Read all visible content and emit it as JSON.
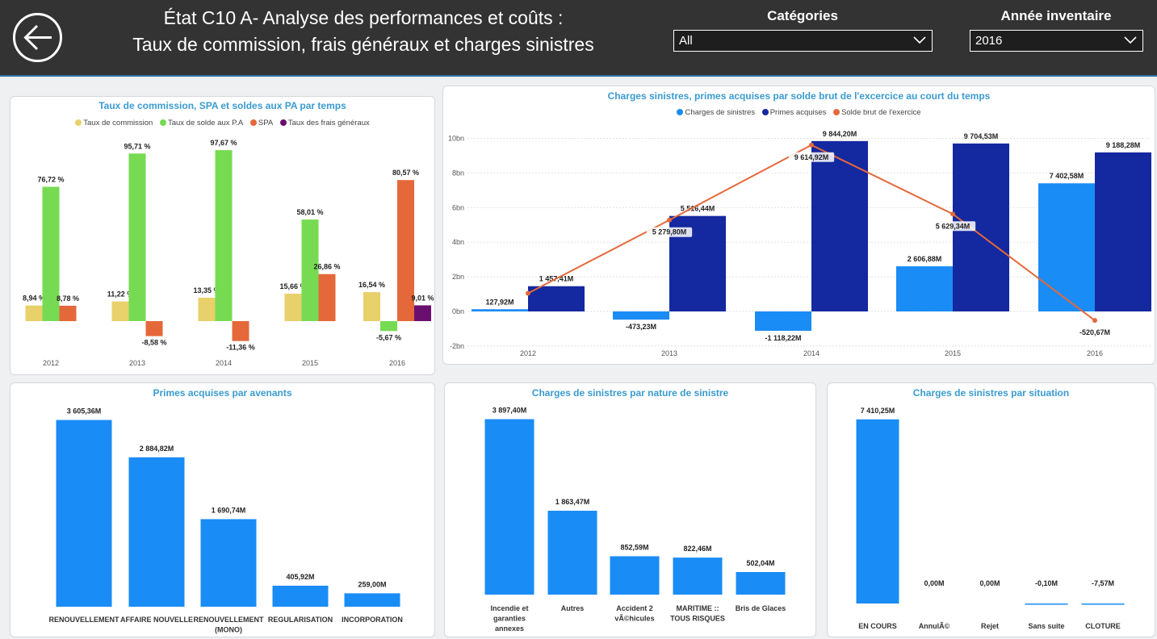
{
  "header": {
    "title_line1": "État C10 A- Analyse des performances et coûts :",
    "title_line2": "Taux de commission, frais généraux et charges sinistres",
    "back_icon": "arrow-left-circle-icon",
    "categories_label": "Catégories",
    "categories_value": "All",
    "annee_label": "Année inventaire",
    "annee_value": "2016"
  },
  "chart_data": [
    {
      "type": "bar",
      "title": "Taux de commission, SPA et soldes aux PA par temps",
      "categories": [
        "2012",
        "2013",
        "2014",
        "2015",
        "2016"
      ],
      "series": [
        {
          "name": "Taux de commission",
          "color": "#e8d06a",
          "values": [
            8.94,
            11.22,
            13.35,
            15.66,
            16.54
          ],
          "labels": [
            "8,94 %",
            "11,22 %",
            "13,35 %",
            "15,66 %",
            "16,54 %"
          ]
        },
        {
          "name": "Taux de solde aux P.A",
          "color": "#76db52",
          "values": [
            76.72,
            95.71,
            97.67,
            58.01,
            -5.67
          ],
          "labels": [
            "76,72 %",
            "95,71 %",
            "97,67 %",
            "58,01 %",
            "-5,67 %"
          ]
        },
        {
          "name": "SPA",
          "color": "#e5683a",
          "values": [
            8.78,
            -8.58,
            -11.36,
            26.86,
            80.57
          ],
          "labels": [
            "8,78 %",
            "-8,58 %",
            "-11,36 %",
            "26,86 %",
            "80,57 %"
          ]
        },
        {
          "name": "Taux des frais généraux",
          "color": "#6a0f6f",
          "values": [
            null,
            null,
            null,
            null,
            9.01
          ],
          "labels": [
            "",
            "",
            "",
            "",
            "9,01 %"
          ]
        }
      ],
      "ylim": [
        -16,
        100
      ]
    },
    {
      "type": "bar",
      "title": "Charges sinistres, primes acquises par solde brut de l'excercice au court du temps",
      "categories": [
        "2012",
        "2013",
        "2014",
        "2015",
        "2016"
      ],
      "yticks": [
        "-2bn",
        "0bn",
        "2bn",
        "4bn",
        "6bn",
        "8bn",
        "10bn"
      ],
      "ylim": [
        -2,
        10
      ],
      "series": [
        {
          "name": "Charges de sinistres",
          "color": "#1a8cf5",
          "values": [
            127.92,
            -473.23,
            -1118.22,
            2606.88,
            7402.58
          ],
          "labels": [
            "127,92M",
            "-473,23M",
            "-1 118,22M",
            "2 606,88M",
            "7 402,58M"
          ]
        },
        {
          "name": "Primes acquises",
          "color": "#1428a0",
          "values": [
            1457.41,
            5516.44,
            9844.2,
            9704.53,
            9188.28
          ],
          "labels": [
            "1 457,41M",
            "5 516,44M",
            "9 844,20M",
            "9 704,53M",
            "9 188,28M"
          ]
        },
        {
          "name": "Solde brut de l'exercice",
          "color": "#e5683a",
          "type": "line",
          "values": [
            1050,
            5279.8,
            9614.92,
            5629.34,
            -520.67
          ],
          "labels": [
            "",
            "5 279,80M",
            "9 614,92M",
            "5 629,34M",
            "-520,67M"
          ]
        }
      ]
    },
    {
      "type": "bar",
      "title": "Primes acquises par avenants",
      "categories": [
        "RENOUVELLEMENT",
        "AFFAIRE NOUVELLE",
        "RENOUVELLEMENT\n(MONO)",
        "REGULARISATION",
        "INCORPORATION"
      ],
      "values": [
        3605.36,
        2884.82,
        1690.74,
        405.92,
        259.0
      ],
      "labels": [
        "3 605,36M",
        "2 884,82M",
        "1 690,74M",
        "405,92M",
        "259,00M"
      ],
      "color": "#1a8cf5"
    },
    {
      "type": "bar",
      "title": "Charges de sinistres par nature de sinistre",
      "categories": [
        "Incendie et\ngaranties\nannexes",
        "Autres",
        "Accident 2\nvÃ©hicules",
        "MARITIME ::\nTOUS RISQUES",
        "Bris de Glaces"
      ],
      "values": [
        3897.4,
        1863.47,
        852.59,
        822.46,
        502.04
      ],
      "labels": [
        "3 897,40M",
        "1 863,47M",
        "852,59M",
        "822,46M",
        "502,04M"
      ],
      "color": "#1a8cf5"
    },
    {
      "type": "bar",
      "title": "Charges de sinistres par situation",
      "categories": [
        "EN COURS",
        "AnnulÃ©",
        "Rejet",
        "Sans suite",
        "CLOTURE"
      ],
      "values": [
        7410.25,
        0.0,
        0.0,
        -0.1,
        -7.57
      ],
      "labels": [
        "7 410,25M",
        "0,00M",
        "0,00M",
        "-0,10M",
        "-7,57M"
      ],
      "color": "#1a8cf5"
    }
  ]
}
